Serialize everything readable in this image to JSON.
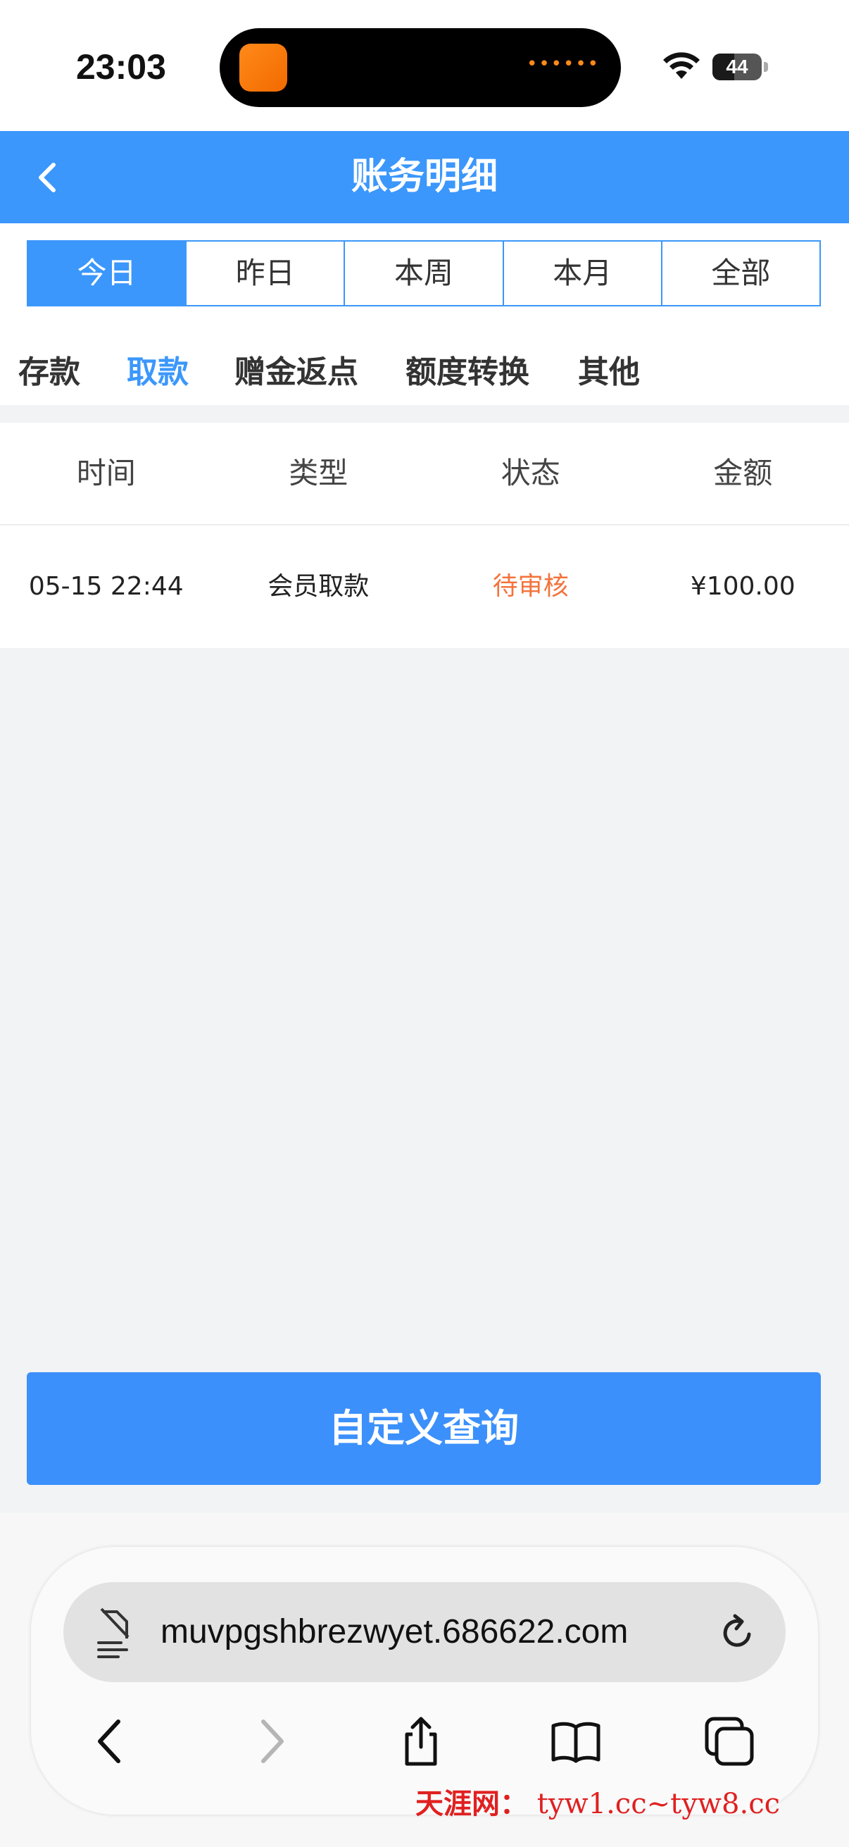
{
  "status_bar": {
    "time": "23:03",
    "battery": "44"
  },
  "header": {
    "title": "账务明细"
  },
  "period_tabs": [
    {
      "label": "今日",
      "active": true
    },
    {
      "label": "昨日",
      "active": false
    },
    {
      "label": "本周",
      "active": false
    },
    {
      "label": "本月",
      "active": false
    },
    {
      "label": "全部",
      "active": false
    }
  ],
  "category_tabs": [
    {
      "label": "存款",
      "active": false
    },
    {
      "label": "取款",
      "active": true
    },
    {
      "label": "赠金返点",
      "active": false
    },
    {
      "label": "额度转换",
      "active": false
    },
    {
      "label": "其他",
      "active": false
    }
  ],
  "table": {
    "columns": [
      "时间",
      "类型",
      "状态",
      "金额"
    ],
    "rows": [
      {
        "time": "05-15 22:44",
        "type": "会员取款",
        "status": "待审核",
        "amount": "¥100.00"
      }
    ]
  },
  "query_button": "自定义查询",
  "browser": {
    "url": "muvpgshbrezwyet.686622.com"
  },
  "watermark": {
    "cn": "天涯网：",
    "url": "tyw1.cc~tyw8.cc"
  },
  "colors": {
    "accent": "#3b97fb",
    "status_pending": "#f4733d"
  }
}
